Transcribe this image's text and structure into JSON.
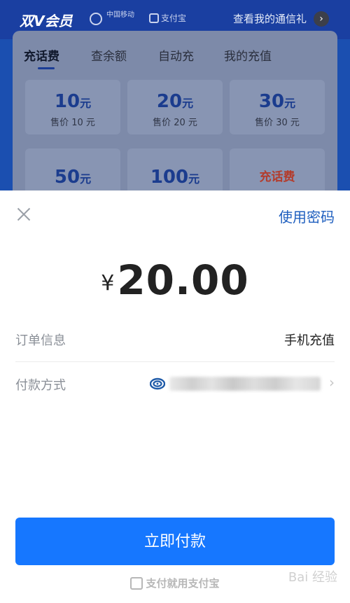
{
  "background_page": {
    "brand": "双V会员",
    "carrier_logo_text": "中国移动",
    "alipay_logo_text": "支付宝",
    "gift_link": "查看我的通信礼",
    "tabs": [
      {
        "label": "充话费",
        "active": true
      },
      {
        "label": "查余额",
        "active": false
      },
      {
        "label": "自动充",
        "active": false
      },
      {
        "label": "我的充值",
        "active": false
      }
    ],
    "tiles": [
      {
        "amount": "10",
        "unit": "元",
        "price": "售价 10 元"
      },
      {
        "amount": "20",
        "unit": "元",
        "price": "售价 20 元"
      },
      {
        "amount": "30",
        "unit": "元",
        "price": "售价 30 元"
      },
      {
        "amount": "50",
        "unit": "元",
        "price": ""
      },
      {
        "amount": "100",
        "unit": "元",
        "price": ""
      },
      {
        "amount": "",
        "unit": "",
        "price": "",
        "label": "充话费"
      }
    ]
  },
  "sheet": {
    "use_password": "使用密码",
    "currency": "¥",
    "amount": "20.00",
    "order_info_label": "订单信息",
    "order_info_value": "手机充值",
    "payment_method_label": "付款方式",
    "payment_method_icon": "bank-swirl-icon",
    "pay_button": "立即付款",
    "footer": "支付就用支付宝"
  },
  "watermark": "Bai 经验",
  "colors": {
    "primary_blue": "#1677ff",
    "link_blue": "#1f5fbf",
    "header_blue": "#1a3fa1"
  }
}
